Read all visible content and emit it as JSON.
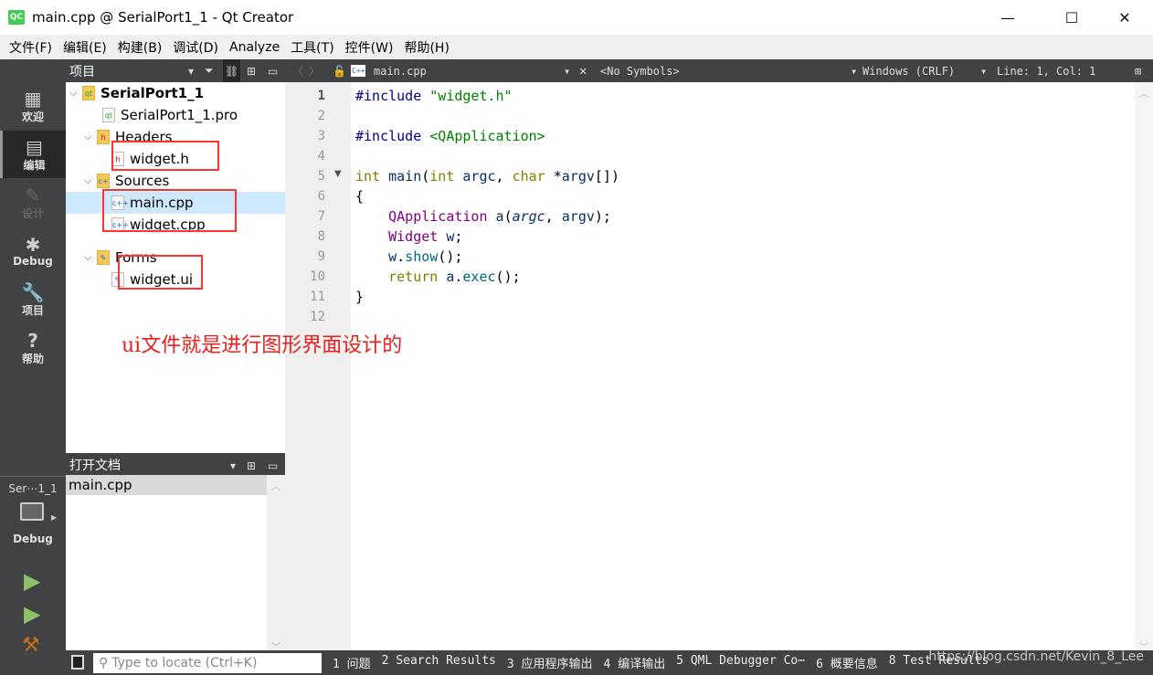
{
  "window": {
    "title": "main.cpp @ SerialPort1_1 - Qt Creator",
    "logo": "QC",
    "minimize": "—",
    "maximize": "☐",
    "close": "✕"
  },
  "menu": [
    "文件(F)",
    "编辑(E)",
    "构建(B)",
    "调试(D)",
    "Analyze",
    "工具(T)",
    "控件(W)",
    "帮助(H)"
  ],
  "modes": [
    {
      "label": "欢迎",
      "icon": "grid-icon",
      "glyph": "▦"
    },
    {
      "label": "编辑",
      "icon": "edit-doc-icon",
      "glyph": "▤"
    },
    {
      "label": "设计",
      "icon": "pencil-icon",
      "glyph": "✎"
    },
    {
      "label": "Debug",
      "icon": "bug-icon",
      "glyph": "✱"
    },
    {
      "label": "项目",
      "icon": "wrench-icon",
      "glyph": "🔧"
    },
    {
      "label": "帮助",
      "icon": "help-icon",
      "glyph": "?"
    }
  ],
  "kit": {
    "name": "Ser⋯1_1",
    "build": "Debug"
  },
  "project_panel": {
    "title": "项目",
    "tree": [
      {
        "label": "SerialPort1_1",
        "type": "project",
        "icon": "qt-project-folder-icon",
        "glyph": "qt"
      },
      {
        "label": "SerialPort1_1.pro",
        "type": "file",
        "icon": "pro-file-icon",
        "glyph": "qt"
      },
      {
        "label": "Headers",
        "type": "folder",
        "icon": "headers-folder-icon",
        "glyph": "h"
      },
      {
        "label": "widget.h",
        "type": "file",
        "icon": "header-file-icon",
        "glyph": "h"
      },
      {
        "label": "Sources",
        "type": "folder",
        "icon": "sources-folder-icon",
        "glyph": "c+"
      },
      {
        "label": "main.cpp",
        "type": "file",
        "icon": "cpp-file-icon",
        "glyph": "c++",
        "selected": true
      },
      {
        "label": "widget.cpp",
        "type": "file",
        "icon": "cpp-file-icon",
        "glyph": "c++"
      },
      {
        "label": "Forms",
        "type": "folder",
        "icon": "forms-folder-icon",
        "glyph": "✎"
      },
      {
        "label": "widget.ui",
        "type": "file",
        "icon": "ui-file-icon",
        "glyph": "✎"
      }
    ]
  },
  "open_docs": {
    "title": "打开文档",
    "items": [
      "main.cpp"
    ]
  },
  "editor": {
    "file": "main.cpp",
    "symbols": "<No Symbols>",
    "line_ending": "Windows (CRLF)",
    "position": "Line: 1, Col: 1",
    "current_line": 1,
    "lines": [
      [
        [
          "#include ",
          "pre"
        ],
        [
          "\"widget.h\"",
          "str"
        ]
      ],
      [],
      [
        [
          "#include ",
          "pre"
        ],
        [
          "<QApplication>",
          "str"
        ]
      ],
      [],
      [
        [
          "int ",
          "kw"
        ],
        [
          "main",
          "var"
        ],
        [
          "(",
          "plain"
        ],
        [
          "int ",
          "kw"
        ],
        [
          "argc",
          "var"
        ],
        [
          ", ",
          "plain"
        ],
        [
          "char ",
          "kw"
        ],
        [
          "*",
          "plain"
        ],
        [
          "argv",
          "var"
        ],
        [
          "[])",
          "plain"
        ]
      ],
      [
        [
          "{",
          "plain"
        ]
      ],
      [
        [
          "    ",
          "plain"
        ],
        [
          "QApplication ",
          "type"
        ],
        [
          "a",
          "var"
        ],
        [
          "(",
          "plain"
        ],
        [
          "argc",
          "param"
        ],
        [
          ", ",
          "plain"
        ],
        [
          "argv",
          "var"
        ],
        [
          ");",
          "plain"
        ]
      ],
      [
        [
          "    ",
          "plain"
        ],
        [
          "Widget ",
          "type"
        ],
        [
          "w",
          "var"
        ],
        [
          ";",
          "plain"
        ]
      ],
      [
        [
          "    ",
          "plain"
        ],
        [
          "w",
          "var"
        ],
        [
          ".",
          "plain"
        ],
        [
          "show",
          "fn"
        ],
        [
          "();",
          "plain"
        ]
      ],
      [
        [
          "    ",
          "plain"
        ],
        [
          "return ",
          "kw"
        ],
        [
          "a",
          "var"
        ],
        [
          ".",
          "plain"
        ],
        [
          "exec",
          "fn"
        ],
        [
          "();",
          "plain"
        ]
      ],
      [
        [
          "}",
          "plain"
        ]
      ],
      []
    ]
  },
  "annotation": "ui文件就是进行图形界面设计的",
  "bottom": {
    "locate_placeholder": "Type to locate (Ctrl+K)",
    "tabs": [
      "1 问题",
      "2 Search Results",
      "3 应用程序输出",
      "4 编译输出",
      "5 QML Debugger Co⋯",
      "6 概要信息",
      "8 Test Results"
    ]
  },
  "watermark": "https://blog.csdn.net/Kevin_8_Lee",
  "colors": {
    "highlight_box": "#ff3333",
    "selection": "#cde8ff",
    "annotation": "#e8201c",
    "run": "#8fc16a"
  }
}
